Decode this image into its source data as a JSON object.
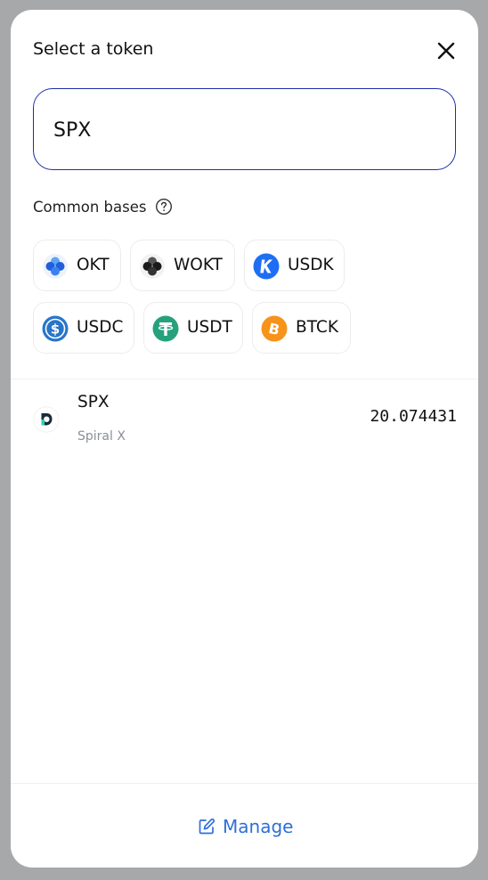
{
  "modal": {
    "title": "Select a token",
    "close_icon": "close-icon"
  },
  "search": {
    "value": "SPX",
    "placeholder": ""
  },
  "common_bases": {
    "label": "Common bases",
    "help_icon": "question-circle-icon",
    "tokens": [
      {
        "symbol": "OKT",
        "icon": "okt-logo-icon"
      },
      {
        "symbol": "WOKT",
        "icon": "wokt-logo-icon"
      },
      {
        "symbol": "USDK",
        "icon": "usdk-logo-icon"
      },
      {
        "symbol": "USDC",
        "icon": "usdc-logo-icon"
      },
      {
        "symbol": "USDT",
        "icon": "usdt-logo-icon"
      },
      {
        "symbol": "BTCK",
        "icon": "btck-logo-icon"
      }
    ]
  },
  "token_list": [
    {
      "symbol": "SPX",
      "name": "Spiral X",
      "balance": "20.074431",
      "icon": "spiral-x-logo-icon"
    }
  ],
  "footer": {
    "manage_label": "Manage",
    "manage_icon": "edit-icon"
  },
  "colors": {
    "accent": "#2f6fd8",
    "search_border": "#1f2ea8",
    "usdk": "#1e6ef3",
    "usdc": "#2775ca",
    "usdt": "#26a17b",
    "btck": "#f7931a"
  }
}
